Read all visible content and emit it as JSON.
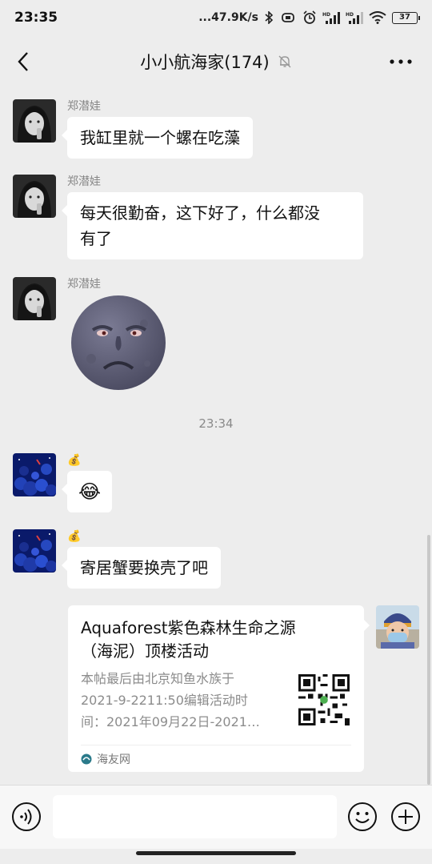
{
  "status_bar": {
    "time": "23:35",
    "network_speed": "...47.9K/s",
    "battery": "37"
  },
  "header": {
    "title": "小小航海家(174)"
  },
  "messages": [
    {
      "sender": "郑潜娃",
      "text": "我缸里就一个螺在吃藻"
    },
    {
      "sender": "郑潜娃",
      "text_line1": "每天很勤奋，这下好了，什么都没",
      "text_line2": "有了"
    },
    {
      "sender": "郑潜娃",
      "sticker": "frowning-moon-face-sticker"
    },
    {
      "sender_emoji": "💰",
      "text": "😂"
    },
    {
      "sender_emoji": "💰",
      "text": "寄居蟹要换壳了吧"
    }
  ],
  "timestamp": "23:34",
  "link_card": {
    "title_line1": "Aquaforest紫色森林生命之源",
    "title_line2": "（海泥）顶楼活动",
    "desc_line1": "本帖最后由北京知鱼水族于",
    "desc_line2": "2021-9-2211:50编辑活动时",
    "desc_line3": "间：2021年09月22日-2021…",
    "source": "海友网"
  },
  "input_bar": {
    "placeholder": ""
  },
  "colors": {
    "background": "#ededed",
    "bubble": "#ffffff",
    "secondary_text": "#888888"
  }
}
